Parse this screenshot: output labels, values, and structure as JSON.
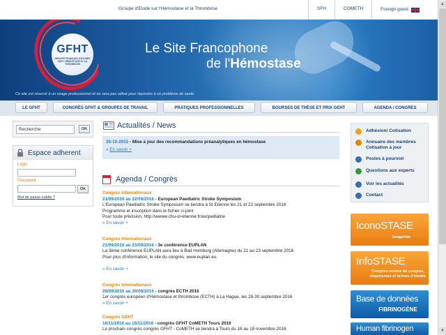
{
  "top": {
    "site_name": "Groupe d'Etude sur l'Hémostase et la Thrombose",
    "links": [
      "SFH",
      "COMETH"
    ],
    "guest_label": "Foreign guest"
  },
  "banner": {
    "logo": "GFHT",
    "logo_sub": "GROUPE FRANÇAIS D'ÉTUDES SUR L'HÉMOSTASE ET LA THROMBOSE",
    "title_line1": "Le Site Francophone",
    "title_line2_prefix": "de l'",
    "title_line2_bold": "Hémostase",
    "note": "Ce site est réservé à un usage professionnel et ne sera pas utilisé pour répondre à un problème de santé."
  },
  "nav": {
    "items": [
      "LE GFHT",
      "CONGRÈS GFHT & GROUPES DE TRAVAIL",
      "PRATIQUES PROFESSIONNELLES",
      "BOURSES DE THÈSE ET PRIX GEHT",
      "AGENDA / CONGRES"
    ]
  },
  "search": {
    "value": "Recherche",
    "ok": "OK"
  },
  "member": {
    "title": "Espace adherent",
    "login_label": "Login",
    "password_label": "Password",
    "ok": "OK",
    "forgot": "Mot de passe oublié ?"
  },
  "news": {
    "title": "Actualités / News",
    "date": "26-10-2015",
    "text": " - Mise à jour des recommandations préanalytiques en hémostase",
    "more_prefix": "» ",
    "more": "En savoir +"
  },
  "agenda": {
    "title": "Agenda / Congrès",
    "events": [
      {
        "category": "Congrès Internationaux",
        "date": "21/09/2016 au 22/09/2016",
        "title": " - European Paediatric Stroke Symposium",
        "lines": [
          "L'European Paediatric Stroke Symposium se tiendra à St Etienne les 21 et 22 septembre 2016",
          "Programme et inscription dans le fichier ci-joint",
          "Pour toute précision, http://wwww.chu-st-etienne.fr/avcpediatrie"
        ],
        "more": "En savoir +"
      },
      {
        "category": "Congrès Internationaux",
        "date": "21/09/2016 au 23/09/2016",
        "title": " - 3e conférence EUPLAN",
        "lines": [
          "La 3ème conférence EUPLAN aura lieu à Bad Homburg (Allemagne) du 21 au 23 septembre 2016",
          "Pour plus d'information, le site du congrès: www.euplan.eu."
        ],
        "more": "En savoir +"
      },
      {
        "category": "Congrès Internationaux",
        "date": "28/09/2016 au 30/09/2016",
        "title": " - congrès ECTH 2016",
        "lines": [
          "1er congrès européen d'Hémostase et thrombose (ECTH) à La Hague, les 28-30 septembre 2016"
        ],
        "more": "En savoir +"
      },
      {
        "category": "Congrès GEHT",
        "date": "16/11/2016 au 18/11/2016",
        "title": " - congrès GFHT CoMETH Tours 2016",
        "lines": [
          "Le prochain congrès congrès GFHT - CoMETH se tiendra à Tours du 16 au 18 novembre 2016"
        ],
        "more": ""
      }
    ]
  },
  "sidebar": {
    "items": [
      "Adhésion/ Cotisation",
      "Annuaire des membres Cotisation à jour",
      "Postes à pourvoir",
      "Questions aux experts",
      "Voir les actualités",
      "Contact"
    ],
    "icon_colors": [
      "#f2a21c",
      "#e08a00",
      "#3a6cb0",
      "#2f9a3a",
      "#3a6cb0",
      "#3a6cb0"
    ]
  },
  "promos": {
    "icono_title": "IconoSTASE",
    "icono_sub": "Imageries",
    "info_title": "InfoSTASE",
    "info_sub": "Comptes rendus de congrès, diaporamas et brèves d'études",
    "base_title": "Base de données",
    "base_sub": "FIBRINOGÈNE",
    "human_title": "Human fibrinogen"
  },
  "scroll": {
    "up": "▲",
    "down": "▼"
  }
}
